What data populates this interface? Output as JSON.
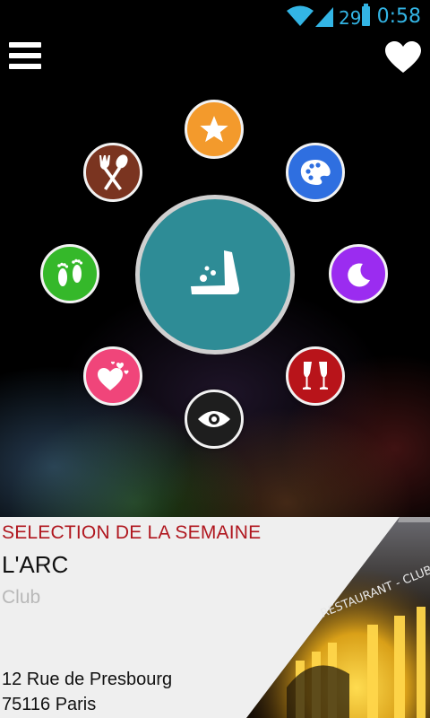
{
  "status_bar": {
    "battery_level": "29",
    "time": "0:58",
    "icons": [
      "wifi-icon",
      "signal-icon",
      "battery-icon"
    ],
    "accent_color": "#33b5e5"
  },
  "header": {
    "menu_icon": "hamburger-menu-icon",
    "favorites_icon": "heart-icon"
  },
  "categories": [
    {
      "icon": "star-icon",
      "color": "#f39a2c"
    },
    {
      "icon": "palette-icon",
      "color": "#2f6fe0"
    },
    {
      "icon": "moon-icon",
      "color": "#9b2cf0"
    },
    {
      "icon": "champagne-icon",
      "color": "#b8141a"
    },
    {
      "icon": "eye-icon",
      "color": "#1e1e1e"
    },
    {
      "icon": "hearts-icon",
      "color": "#f0457a"
    },
    {
      "icon": "footprints-icon",
      "color": "#35b82a"
    },
    {
      "icon": "fork-spoon-icon",
      "color": "#7a3420"
    }
  ],
  "center_button": {
    "icon": "logo-icon",
    "color": "#2e8c96"
  },
  "selection": {
    "heading": "SELECTION DE LA SEMAINE",
    "name": "L'ARC",
    "type": "Club",
    "address_line1": "12 Rue de Presbourg",
    "address_line2": "75116 Paris",
    "photo_sign_text": "RESTAURANT - CLUB",
    "heading_color": "#b0171f"
  }
}
